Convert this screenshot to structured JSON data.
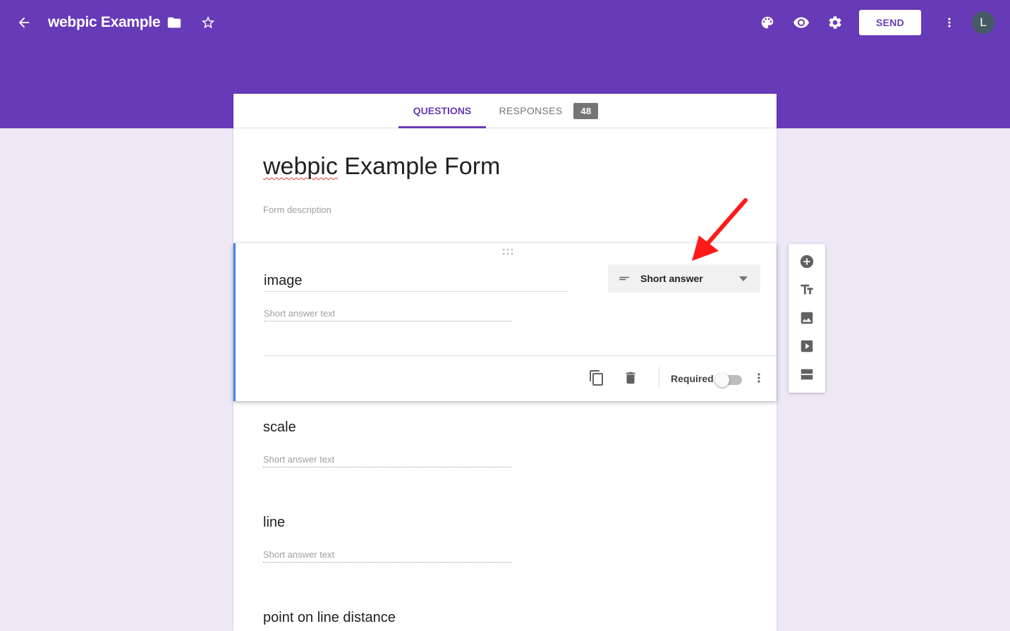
{
  "header": {
    "app_title": "webpic Example",
    "send_label": "SEND",
    "avatar_initial": "L",
    "colors": {
      "brand": "#673ab7",
      "background": "#ede7f6",
      "accent_active": "#4285f4"
    }
  },
  "tabs": {
    "questions_label": "QUESTIONS",
    "responses_label": "RESPONSES",
    "responses_count": "48",
    "active": "questions"
  },
  "form": {
    "title_first_word": "webpic",
    "title_rest": " Example Form",
    "description_placeholder": "Form description"
  },
  "active_question": {
    "title": "image",
    "answer_placeholder": "Short answer text",
    "type_label": "Short answer",
    "required_label": "Required",
    "required": false
  },
  "questions": [
    {
      "title": "scale",
      "answer_placeholder": "Short answer text"
    },
    {
      "title": "line",
      "answer_placeholder": "Short answer text"
    },
    {
      "title": "point on line distance"
    }
  ],
  "icons": {
    "header": [
      "back-arrow-icon",
      "folder-icon",
      "star-icon",
      "palette-icon",
      "preview-eye-icon",
      "settings-gear-icon",
      "more-vert-icon"
    ],
    "question_footer": [
      "duplicate-icon",
      "delete-icon",
      "more-vert-icon"
    ],
    "side_toolbar": [
      "add-question-icon",
      "add-title-icon",
      "add-image-icon",
      "add-video-icon",
      "add-section-icon"
    ]
  }
}
